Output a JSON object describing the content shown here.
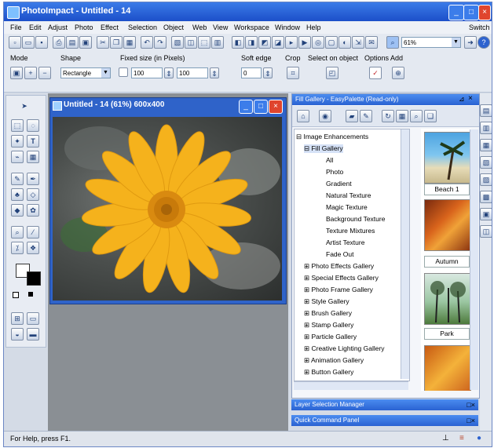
{
  "titlebar": {
    "title": "PhotoImpact - Untitled - 14"
  },
  "menu": {
    "items": [
      "File",
      "Edit",
      "Adjust",
      "Photo",
      "Effect",
      "Selection",
      "Object",
      "Web",
      "View",
      "Workspace",
      "Window",
      "Help"
    ],
    "switch": "Switch"
  },
  "toolbar": {
    "zoom_value": "61%"
  },
  "options": {
    "mode_label": "Mode",
    "shape_label": "Shape",
    "shape_value": "Rectangle",
    "fixed_size_label": "Fixed size (in Pixels)",
    "width_value": "100",
    "height_value": "100",
    "soft_edge_label": "Soft edge",
    "soft_edge_value": "0",
    "crop_label": "Crop",
    "select_on_object_label": "Select on object",
    "options_label": "Options",
    "add_label": "Add"
  },
  "document": {
    "title": "Untitled - 14 (61%) 600x400"
  },
  "gallery": {
    "title": "Fill Gallery - EasyPalette (Read-only)",
    "tree": {
      "root": "Image Enhancements",
      "fill_gallery": "Fill Gallery",
      "fill_children": [
        "All",
        "Photo",
        "Gradient",
        "Natural Texture",
        "Magic Texture",
        "Background Texture",
        "Texture Mixtures",
        "Artist Texture",
        "Fade Out"
      ],
      "galleries": [
        "Photo Effects Gallery",
        "Special Effects Gallery",
        "Photo Frame Gallery",
        "Style Gallery",
        "Brush Gallery",
        "Stamp Gallery",
        "Particle Gallery",
        "Creative Lighting Gallery",
        "Animation Gallery",
        "Button Gallery"
      ]
    },
    "thumbnails": [
      "Beach 1",
      "Autumn",
      "Park"
    ]
  },
  "panels": {
    "layer_manager": "Layer Selection Manager",
    "quick_command": "Quick Command Panel"
  },
  "status": {
    "text": "For Help, press F1."
  },
  "colors": {
    "titlebar": "#1c4fc9",
    "workspace": "#8a8f94",
    "flower": "#f5b21c",
    "flower_center": "#d98a10"
  },
  "icons": [
    "app-icon",
    "minimize-icon",
    "maximize-icon",
    "close-icon",
    "new-icon",
    "open-icon",
    "save-icon",
    "print-icon",
    "undo-icon",
    "redo-icon",
    "zoom-icon",
    "pointer-icon",
    "text-icon",
    "brush-icon",
    "eyedropper-icon",
    "fill-icon",
    "magnifier-icon",
    "folder-icon",
    "refresh-icon",
    "search-icon",
    "pin-icon",
    "ruler-icon",
    "grid-icon",
    "globe-icon"
  ]
}
